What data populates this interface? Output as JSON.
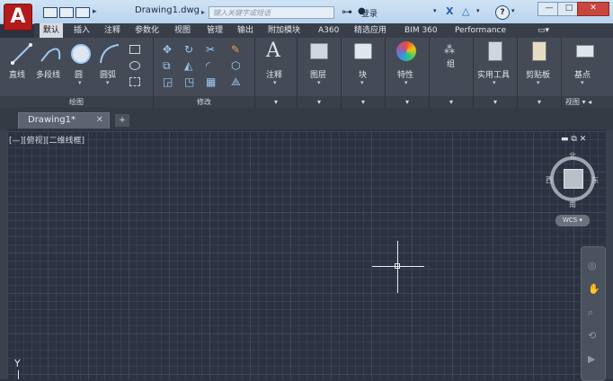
{
  "window": {
    "document_title": "Drawing1.dwg",
    "search_placeholder": "键入关键字或短语",
    "login_label": "登录",
    "help_label": "?"
  },
  "app_button_label": "A",
  "ribbon_tabs": [
    "默认",
    "插入",
    "注释",
    "参数化",
    "视图",
    "管理",
    "输出",
    "附加模块",
    "A360",
    "精选应用",
    "BIM 360",
    "Performance"
  ],
  "active_tab_index": 0,
  "ribbon": {
    "draw_tools": [
      "直线",
      "多段线",
      "圆",
      "圆弧"
    ],
    "draw_panel_label": "绘图",
    "modify_panel_label": "修改",
    "annotation_label": "注释",
    "layers_label": "图层",
    "block_label": "块",
    "properties_label": "特性",
    "groups_label": "组",
    "utilities_label": "实用工具",
    "clipboard_label": "剪贴板",
    "basepoint_label": "基点",
    "view_panel_label": "视图"
  },
  "doc_tabs": [
    {
      "label": "Drawing1*"
    }
  ],
  "viewport": {
    "label": "[—][俯视][二维线框]",
    "compass": {
      "north": "北",
      "south": "南",
      "east": "东",
      "west": "西"
    },
    "wcs_label": "WCS",
    "y_axis_label": "Y"
  },
  "colors": {
    "app_red": "#b31b1b",
    "canvas_bg": "#2b3341",
    "ribbon_bg": "#444b56",
    "title_bg": "#c6dcf2"
  }
}
